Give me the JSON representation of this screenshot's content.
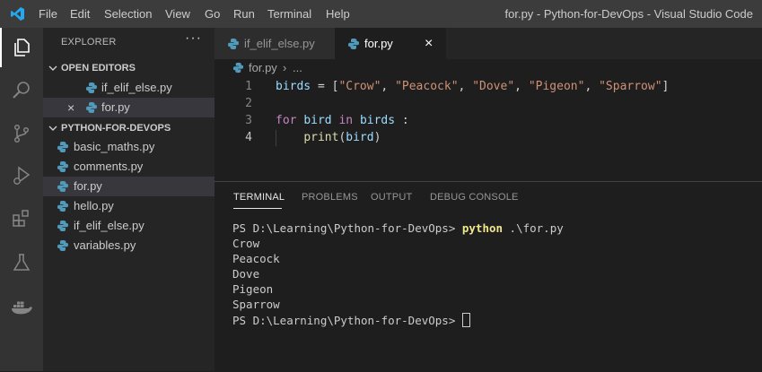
{
  "titlebar": {
    "menu": [
      "File",
      "Edit",
      "Selection",
      "View",
      "Go",
      "Run",
      "Terminal",
      "Help"
    ],
    "window_title": "for.py - Python-for-DevOps - Visual Studio Code"
  },
  "activity_bar": {
    "icons": [
      "explorer-icon",
      "search-icon",
      "source-control-icon",
      "run-debug-icon",
      "extensions-icon",
      "testing-icon",
      "docker-icon"
    ]
  },
  "sidebar": {
    "title": "EXPLORER",
    "more": "···",
    "open_editors": {
      "label": "OPEN EDITORS",
      "items": [
        {
          "name": "if_elif_else.py"
        },
        {
          "name": "for.py",
          "close": "×"
        }
      ]
    },
    "folder": {
      "label": "PYTHON-FOR-DEVOPS",
      "files": [
        "basic_maths.py",
        "comments.py",
        "for.py",
        "hello.py",
        "if_elif_else.py",
        "variables.py"
      ]
    }
  },
  "tabs": [
    {
      "label": "if_elif_else.py",
      "active": false
    },
    {
      "label": "for.py",
      "active": true,
      "close": "×"
    }
  ],
  "breadcrumb": {
    "file": "for.py",
    "sep": "›",
    "rest": "..."
  },
  "editor": {
    "line_numbers": [
      "1",
      "2",
      "3",
      "4"
    ],
    "line1": {
      "var": "birds",
      "eq": " = [",
      "s1": "\"Crow\"",
      "s2": "\"Peacock\"",
      "s3": "\"Dove\"",
      "s4": "\"Pigeon\"",
      "s5": "\"Sparrow\"",
      "comma": ", ",
      "end": "]"
    },
    "line3": {
      "kw_for": "for",
      "v1": "bird",
      "kw_in": "in",
      "v2": "birds",
      "colon": " :"
    },
    "line4": {
      "fn": "print",
      "open": "(",
      "arg": "bird",
      "close": ")"
    }
  },
  "panel": {
    "tabs": [
      "TERMINAL",
      "PROBLEMS",
      "OUTPUT",
      "DEBUG CONSOLE"
    ],
    "terminal": {
      "prompt": "PS D:\\Learning\\Python-for-DevOps> ",
      "command": "python",
      "command_arg": " .\\for.py",
      "output": [
        "Crow",
        "Peacock",
        "Dove",
        "Pigeon",
        "Sparrow"
      ],
      "final_prompt": "PS D:\\Learning\\Python-for-DevOps> "
    }
  },
  "colors": {
    "accent": "#007acc",
    "python_icon": "#519aba"
  }
}
